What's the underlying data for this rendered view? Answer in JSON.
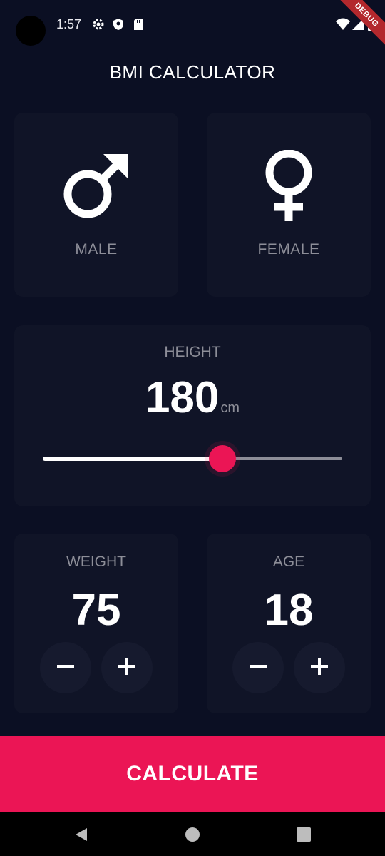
{
  "status_bar": {
    "time": "1:57",
    "icons": [
      "gear-icon",
      "shield-icon",
      "sd-card-icon",
      "wifi-icon",
      "signal-icon",
      "battery-icon"
    ]
  },
  "debug_banner": "DEBUG",
  "app": {
    "title": "BMI CALCULATOR"
  },
  "gender": {
    "male_label": "MALE",
    "female_label": "FEMALE"
  },
  "height": {
    "label": "HEIGHT",
    "value": "180",
    "unit": "cm",
    "slider_fraction": 0.6
  },
  "weight": {
    "label": "WEIGHT",
    "value": "75"
  },
  "age": {
    "label": "AGE",
    "value": "18"
  },
  "counter_buttons": {
    "minus_icon": "minus-icon",
    "plus_icon": "plus-icon"
  },
  "calculate": {
    "label": "CALCULATE"
  },
  "colors": {
    "background": "#0b0f23",
    "card": "#101427",
    "accent": "#eb1555",
    "muted_text": "#8d8e98"
  },
  "nav": {
    "icons": [
      "back-icon",
      "home-icon",
      "recents-icon"
    ]
  }
}
